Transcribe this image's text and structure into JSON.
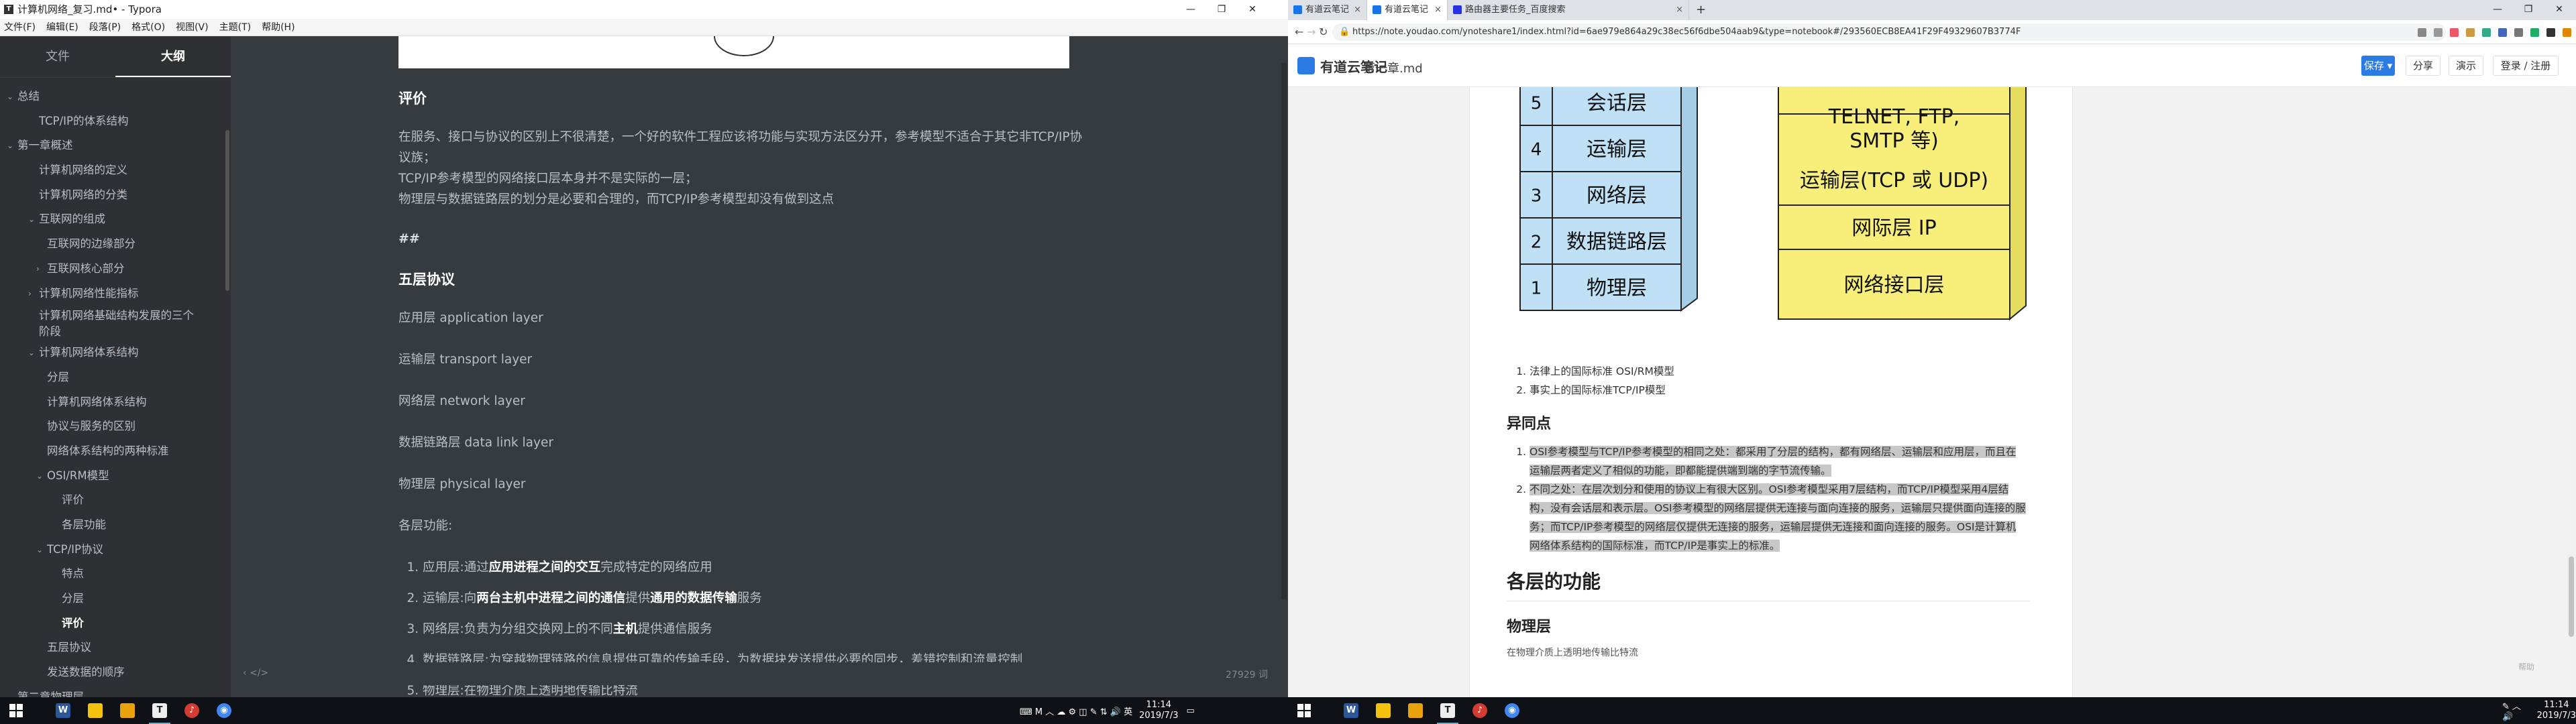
{
  "typora": {
    "title": "计算机网络_复习.md• - Typora",
    "menu": [
      "文件(F)",
      "编辑(E)",
      "段落(P)",
      "格式(O)",
      "视图(V)",
      "主题(T)",
      "帮助(H)"
    ],
    "tabs": {
      "files": "文件",
      "outline": "大纲"
    },
    "outline": [
      {
        "label": "总结",
        "level": 0,
        "toggle": "open"
      },
      {
        "label": "TCP/IP的体系结构",
        "level": 1
      },
      {
        "label": "第一章概述",
        "level": 0,
        "toggle": "open"
      },
      {
        "label": "计算机网络的定义",
        "level": 1
      },
      {
        "label": "计算机网络的分类",
        "level": 1
      },
      {
        "label": "互联网的组成",
        "level": 1,
        "toggle": "open"
      },
      {
        "label": "互联网的边缘部分",
        "level": 2
      },
      {
        "label": "互联网核心部分",
        "level": 2,
        "toggle": "closed"
      },
      {
        "label": "计算机网络性能指标",
        "level": 1,
        "toggle": "closed"
      },
      {
        "label": "计算机网络基础结构发展的三个阶段",
        "level": 1,
        "two": true
      },
      {
        "label": "计算机网络体系结构",
        "level": 1,
        "toggle": "open"
      },
      {
        "label": "分层",
        "level": 2
      },
      {
        "label": "计算机网络体系结构",
        "level": 2
      },
      {
        "label": "协议与服务的区别",
        "level": 2
      },
      {
        "label": "网络体系结构的两种标准",
        "level": 2
      },
      {
        "label": "OSI/RM模型",
        "level": 2,
        "toggle": "open"
      },
      {
        "label": "评价",
        "level": 3
      },
      {
        "label": "各层功能",
        "level": 3
      },
      {
        "label": "TCP/IP协议",
        "level": 2,
        "toggle": "open"
      },
      {
        "label": "特点",
        "level": 3
      },
      {
        "label": "分层",
        "level": 3
      },
      {
        "label": "评价",
        "level": 3,
        "active": true
      },
      {
        "label": "五层协议",
        "level": 2
      },
      {
        "label": "发送数据的顺序",
        "level": 2
      },
      {
        "label": "第二章物理层",
        "level": 0,
        "toggle": "open"
      }
    ],
    "content": {
      "h_eval": "评价",
      "eval_lines": [
        "在服务、接口与协议的区别上不很清楚，一个好的软件工程应该将功能与实现方法区分开，参考模型不适合于其它非TCP/IP协议族；",
        "TCP/IP参考模型的网络接口层本身并不是实际的一层；",
        "物理层与数据链路层的划分是必要和合理的，而TCP/IP参考模型却没有做到这点"
      ],
      "raw_hash": "##",
      "h_five": "五层协议",
      "layers": [
        "应用层 application layer",
        "运输层 transport layer",
        "网络层 network layer",
        "数据链路层 data link layer",
        "物理层 physical layer"
      ],
      "func_title": "各层功能:",
      "functions": [
        {
          "pre": "应用层:通过",
          "b1": "应用进程之间的交互",
          "mid": "完成特定的网络应用",
          "b2": "",
          "post": ""
        },
        {
          "pre": "运输层:向",
          "b1": "两台主机中进程之间的通信",
          "mid": "提供",
          "b2": "通用的数据传输",
          "post": "服务"
        },
        {
          "pre": "网络层:负责为分组交换网上的不同",
          "b1": "主机",
          "mid": "提供通信服务",
          "b2": "",
          "post": ""
        },
        {
          "pre": "数据链路层:为穿越物理链路的信息提供可靠的传输手段，为数据块发送提供必要的同步，差错控制和流量控制",
          "b1": "",
          "mid": "",
          "b2": "",
          "post": ""
        },
        {
          "pre": "物理层:在物理介质上透明地传输比特流",
          "b1": "",
          "mid": "",
          "b2": "",
          "post": ""
        }
      ]
    },
    "footer": {
      "left": "‹  </>",
      "words": "27929 词"
    }
  },
  "taskbar_left": {
    "apps": [
      {
        "name": "windows-start",
        "color": "#fff"
      },
      {
        "name": "word",
        "color": "#2b579a",
        "glyph": "W"
      },
      {
        "name": "sticky-notes",
        "color": "#f4c20d",
        "glyph": ""
      },
      {
        "name": "file-explorer",
        "color": "#e8a20c",
        "glyph": ""
      },
      {
        "name": "typora",
        "color": "#eeeeee",
        "glyph": "T"
      },
      {
        "name": "netease-music",
        "color": "#d43c33",
        "glyph": "♪"
      },
      {
        "name": "chrome",
        "color": "#4285f4",
        "glyph": "◉"
      }
    ],
    "tray_text": "⌨ M  ︿ ☁ ⚙ ◫ ✎ ⇅ 🔊 英",
    "time": "11:14",
    "date": "2019/7/3"
  },
  "chrome": {
    "tabs": [
      {
        "title": "有道云笔记",
        "active": false
      },
      {
        "title": "有道云笔记",
        "active": true
      },
      {
        "title": "路由器主要任务_百度搜索",
        "active": false
      }
    ],
    "url": "https://note.youdao.com/ynoteshare1/index.html?id=6ae979e864a29c38ec56f6dbe504aab9&type=notebook#/293560ECB8EA41F29F49329607B3774F"
  },
  "youdao": {
    "logo": "有道云笔记",
    "doc_name": "第一章.md",
    "buttons": {
      "save": "保存 ▾",
      "share": "分享",
      "present": "演示",
      "login": "登录 / 注册"
    },
    "osi_layers": [
      {
        "num": "5",
        "name": "会话层"
      },
      {
        "num": "4",
        "name": "运输层"
      },
      {
        "num": "3",
        "name": "网络层"
      },
      {
        "num": "2",
        "name": "数据链路层"
      },
      {
        "num": "1",
        "name": "物理层"
      }
    ],
    "tcp_layers": [
      "TELNET, FTP, SMTP 等)",
      "运输层(TCP 或 UDP)",
      "网际层 IP",
      "网络接口层"
    ],
    "list1": [
      "法律上的国际标准 OSI/RM模型",
      "事实上的国际标准TCP/IP模型"
    ],
    "h_diff": "异同点",
    "diff": [
      "OSI参考模型与TCP/IP参考模型的相同之处：都采用了分层的结构，都有网络层、运输层和应用层，而且在运输层两者定义了相似的功能，即都能提供端到端的字节流传输。",
      "不同之处：在层次划分和使用的协议上有很大区别。OSI参考模型采用7层结构，而TCP/IP模型采用4层结构，没有会话层和表示层。OSI参考模型的网络层提供无连接与面向连接的服务，运输层只提供面向连接的服务；而TCP/IP参考模型的网络层仅提供无连接的服务，运输层提供无连接和面向连接的服务。OSI是计算机网络体系结构的国际标准，而TCP/IP是事实上的标准。"
    ],
    "h_func": "各层的功能",
    "h_phys": "物理层",
    "cut_line": "在物理介质上透明地传输比特流",
    "corner": "帮助"
  },
  "taskbar_right": {
    "apps": [
      {
        "name": "windows-start",
        "color": "#fff"
      },
      {
        "name": "word",
        "color": "#2b579a",
        "glyph": "W"
      },
      {
        "name": "sticky-notes",
        "color": "#f4c20d",
        "glyph": ""
      },
      {
        "name": "file-explorer",
        "color": "#e8a20c",
        "glyph": ""
      },
      {
        "name": "typora",
        "color": "#eeeeee",
        "glyph": "T"
      },
      {
        "name": "netease-music",
        "color": "#d43c33",
        "glyph": "♪"
      },
      {
        "name": "chrome",
        "color": "#4285f4",
        "glyph": "◉"
      }
    ],
    "tray_text": "✎ ︿ 🔊",
    "time": "11:14",
    "date": "2019/7/3"
  },
  "colors": {
    "osi_fill": "#bfe0f5",
    "tcp_fill": "#f7ef7a",
    "accent": "#2c7be5",
    "typora_bg": "#363b40"
  }
}
